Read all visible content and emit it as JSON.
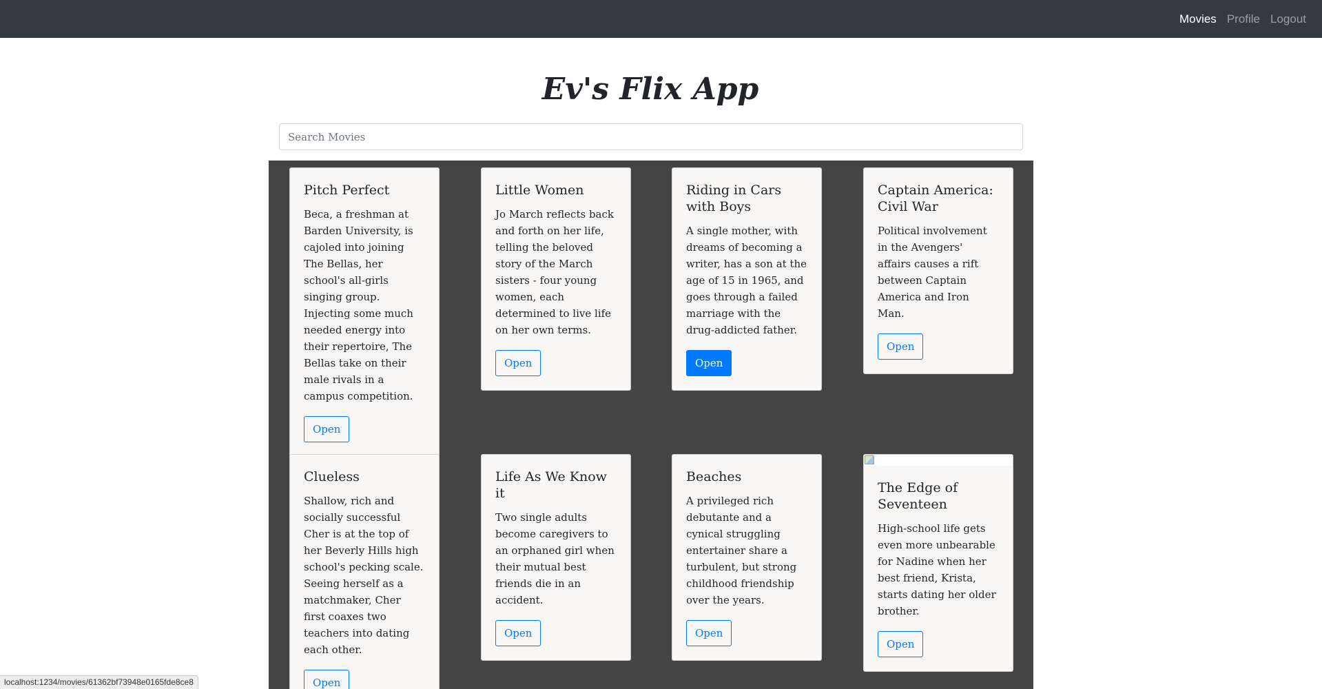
{
  "nav": {
    "links": [
      {
        "label": "Movies",
        "active": true
      },
      {
        "label": "Profile",
        "active": false
      },
      {
        "label": "Logout",
        "active": false
      }
    ]
  },
  "app_title": "Ev's Flix App",
  "search": {
    "placeholder": "Search Movies",
    "value": ""
  },
  "movies": [
    {
      "title": "Pitch Perfect",
      "description": "Beca, a freshman at Barden University, is cajoled into joining The Bellas, her school's all-girls singing group. Injecting some much needed energy into their repertoire, The Bellas take on their male rivals in a campus competition.",
      "button": "Open"
    },
    {
      "title": "Little Women",
      "description": "Jo March reflects back and forth on her life, telling the beloved story of the March sisters - four young women, each determined to live life on her own terms.",
      "button": "Open"
    },
    {
      "title": "Riding in Cars with Boys",
      "description": "A single mother, with dreams of becoming a writer, has a son at the age of 15 in 1965, and goes through a failed marriage with the drug-addicted father.",
      "button": "Open"
    },
    {
      "title": "Captain America: Civil War",
      "description": "Political involvement in the Avengers' affairs causes a rift between Captain America and Iron Man.",
      "button": "Open"
    },
    {
      "title": "Clueless",
      "description": "Shallow, rich and socially successful Cher is at the top of her Beverly Hills high school's pecking scale. Seeing herself as a matchmaker, Cher first coaxes two teachers into dating each other.",
      "button": "Open"
    },
    {
      "title": "Life As We Know it",
      "description": "Two single adults become caregivers to an orphaned girl when their mutual best friends die in an accident.",
      "button": "Open"
    },
    {
      "title": "Beaches",
      "description": "A privileged rich debutante and a cynical struggling entertainer share a turbulent, but strong childhood friendship over the years.",
      "button": "Open"
    },
    {
      "title": "The Edge of Seventeen",
      "description": "High-school life gets even more unbearable for Nadine when her best friend, Krista, starts dating her older brother.",
      "button": "Open"
    }
  ],
  "status_bar": "localhost:1234/movies/61362bf73948e0165fde8ce8",
  "colors": {
    "navbar": "#343a40",
    "grid_bg": "#444444",
    "card_bg": "#f8f7f5",
    "accent": "#007bff"
  }
}
